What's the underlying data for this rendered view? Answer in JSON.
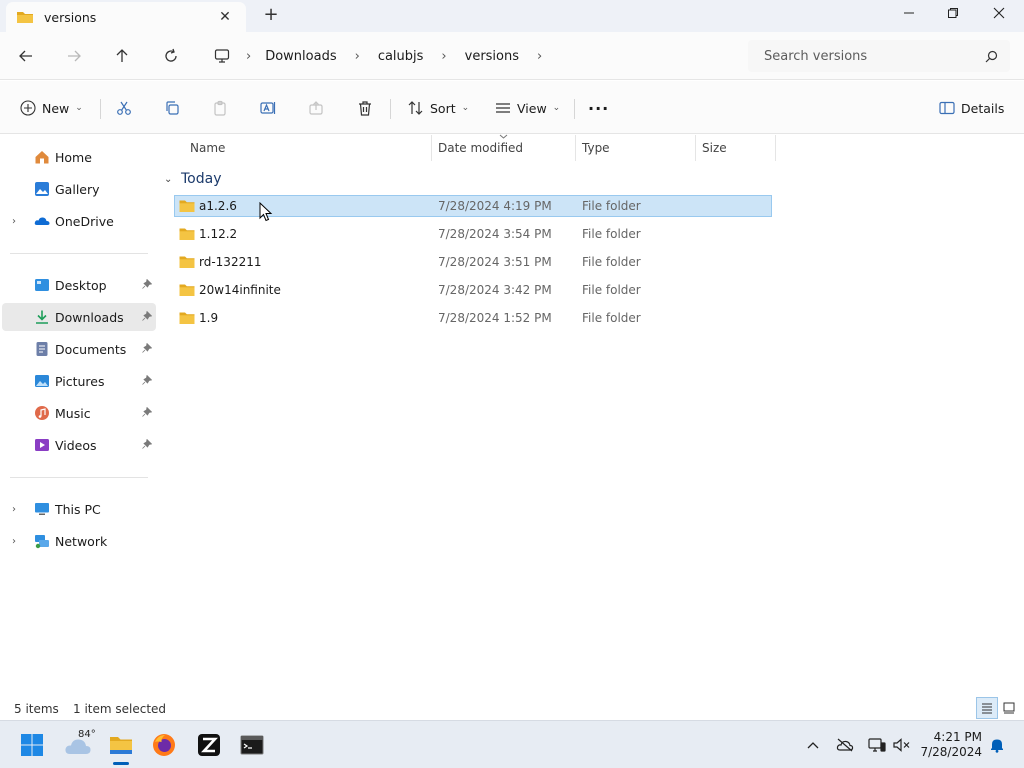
{
  "window": {
    "tab_title": "versions",
    "close_tab_glyph": "✕",
    "new_tab_glyph": "+",
    "minimize_glyph": "—",
    "maximize_glyph": "❐",
    "close_glyph": "✕"
  },
  "breadcrumb": {
    "items": [
      "Downloads",
      "calubjs",
      "versions"
    ],
    "separator": "›"
  },
  "search": {
    "placeholder": "Search versions"
  },
  "toolbar": {
    "new_label": "New",
    "sort_label": "Sort",
    "view_label": "View",
    "more_glyph": "···",
    "details_label": "Details",
    "caret": "⌄"
  },
  "sidebar": {
    "items": [
      {
        "label": "Home",
        "icon": "home-icon"
      },
      {
        "label": "Gallery",
        "icon": "gallery-icon"
      },
      {
        "label": "OneDrive",
        "icon": "onedrive-icon"
      },
      {
        "label": "Desktop",
        "icon": "desktop-icon"
      },
      {
        "label": "Downloads",
        "icon": "downloads-icon"
      },
      {
        "label": "Documents",
        "icon": "documents-icon"
      },
      {
        "label": "Pictures",
        "icon": "pictures-icon"
      },
      {
        "label": "Music",
        "icon": "music-icon"
      },
      {
        "label": "Videos",
        "icon": "videos-icon"
      },
      {
        "label": "This PC",
        "icon": "pc-icon"
      },
      {
        "label": "Network",
        "icon": "network-icon"
      }
    ],
    "expander": "›",
    "pin": "📌"
  },
  "columns": {
    "name": "Name",
    "date": "Date modified",
    "type": "Type",
    "size": "Size"
  },
  "group": {
    "label": "Today",
    "chevron": "⌄"
  },
  "files": [
    {
      "name": "a1.2.6",
      "date": "7/28/2024 4:19 PM",
      "type": "File folder"
    },
    {
      "name": "1.12.2",
      "date": "7/28/2024 3:54 PM",
      "type": "File folder"
    },
    {
      "name": "rd-132211",
      "date": "7/28/2024 3:51 PM",
      "type": "File folder"
    },
    {
      "name": "20w14infinite",
      "date": "7/28/2024 3:42 PM",
      "type": "File folder"
    },
    {
      "name": "1.9",
      "date": "7/28/2024 1:52 PM",
      "type": "File folder"
    }
  ],
  "status": {
    "count": "5 items",
    "selection": "1 item selected"
  },
  "taskbar": {
    "weather_temp": "84°",
    "time": "4:21 PM",
    "date": "7/28/2024"
  },
  "colors": {
    "folder": "#f4c443",
    "folder_dark": "#e3a920",
    "accent": "#005fb8",
    "selection": "#cce4f7"
  }
}
